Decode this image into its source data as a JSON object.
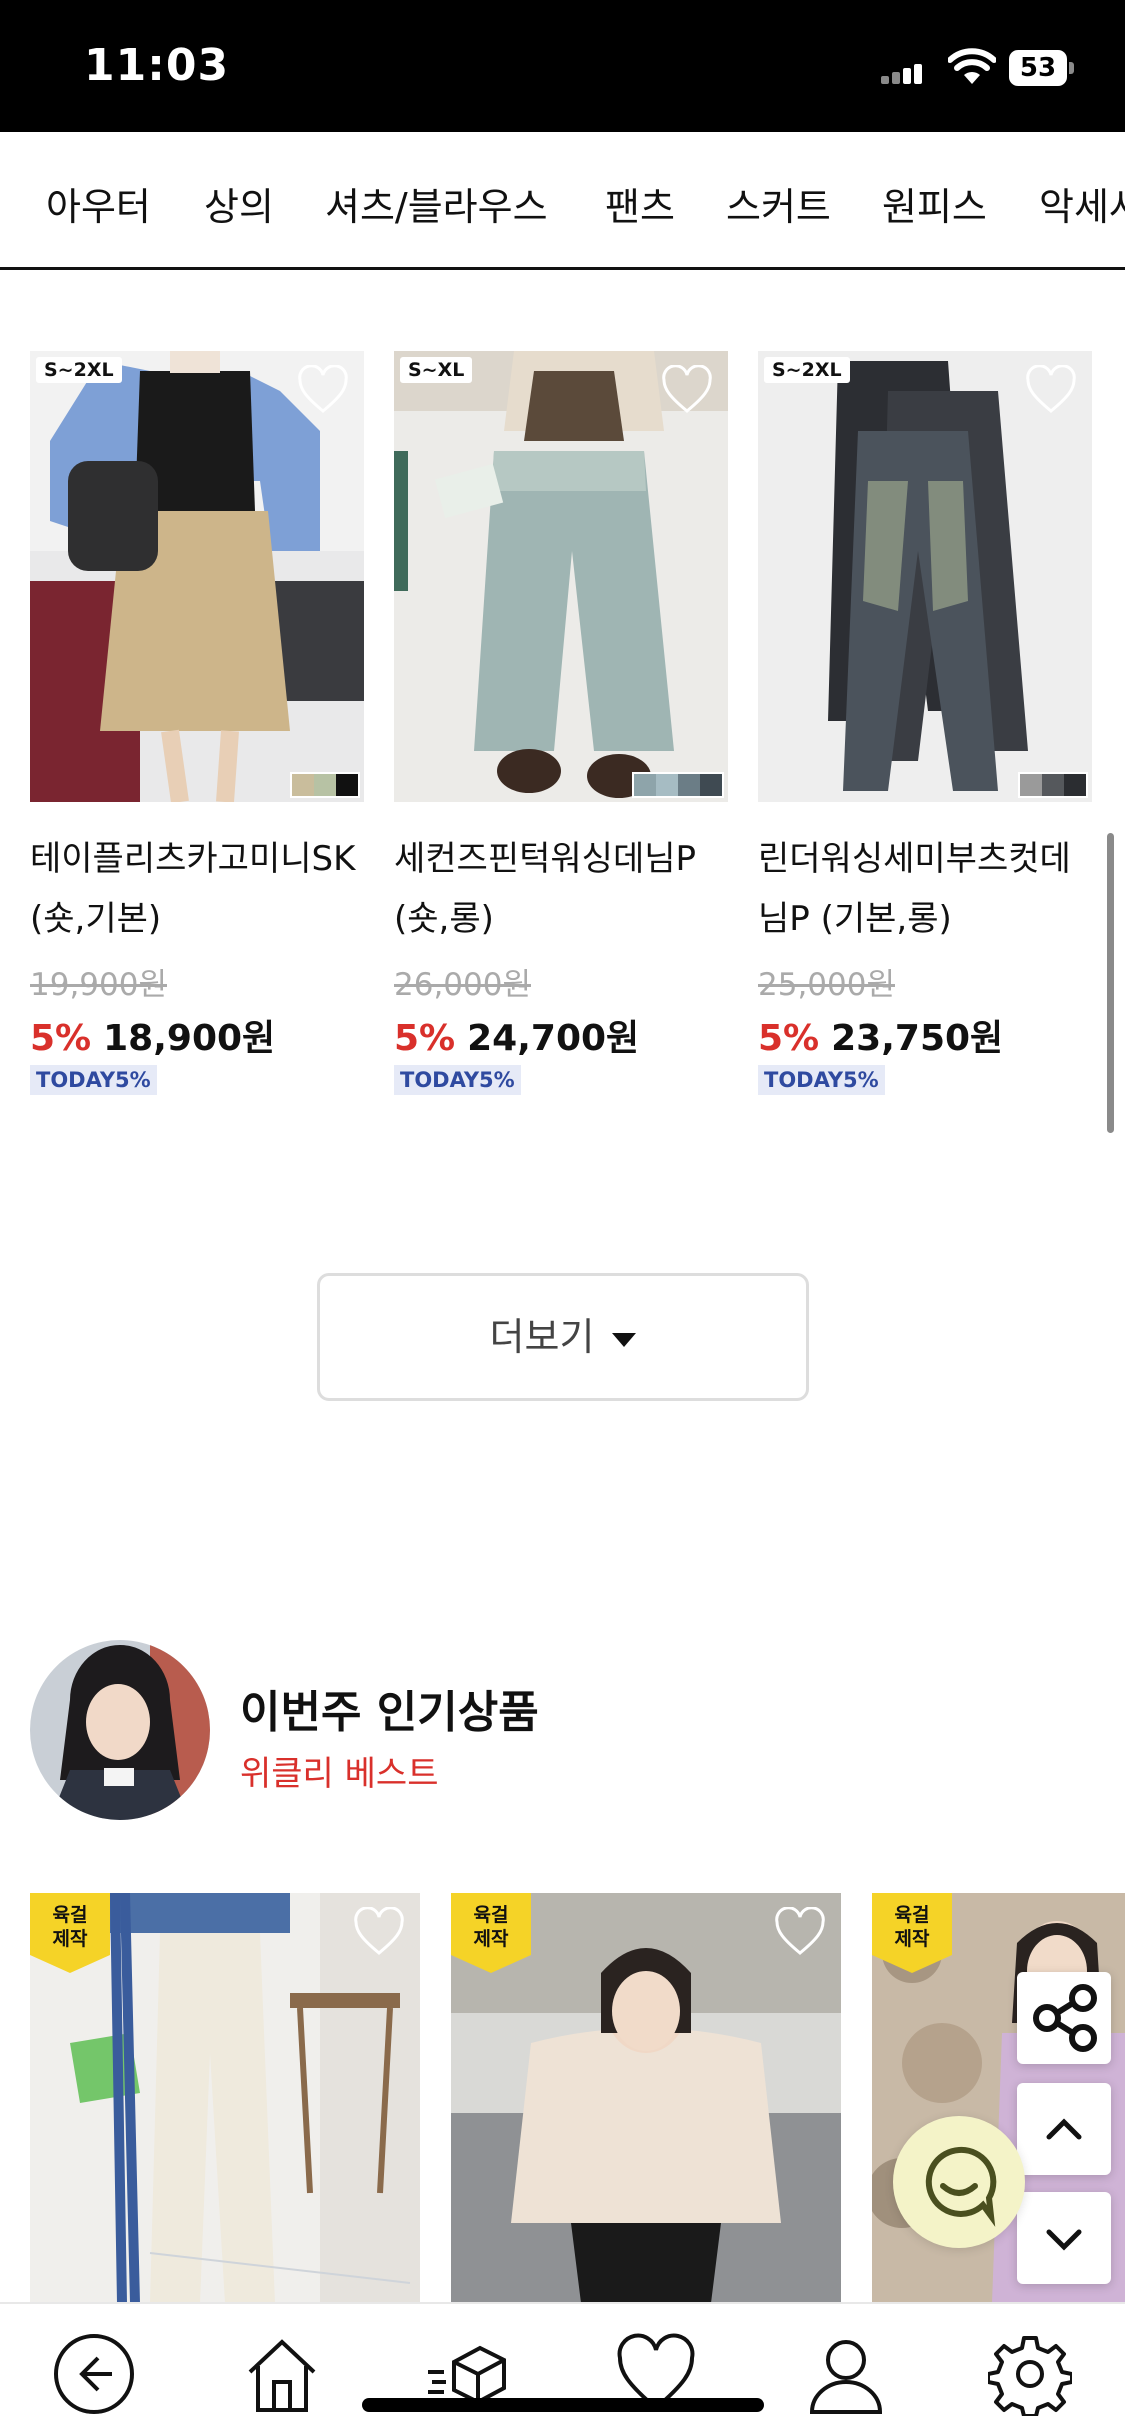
{
  "status_bar": {
    "time": "11:03",
    "battery": "53"
  },
  "categories": [
    "아우터",
    "상의",
    "셔츠/블라우스",
    "팬츠",
    "스커트",
    "원피스",
    "악세사"
  ],
  "products": [
    {
      "size": "S~2XL",
      "name": "테이플리츠카고미니SK (숏,기본)",
      "original_price": "19,900원",
      "discount": "5%",
      "price": "18,900원",
      "badge": "TODAY5%",
      "swatch_colors": [
        "#c9bd9c",
        "#b7c2a4",
        "#111111"
      ]
    },
    {
      "size": "S~XL",
      "name": "세컨즈핀턱워싱데님P (숏,롱)",
      "original_price": "26,000원",
      "discount": "5%",
      "price": "24,700원",
      "badge": "TODAY5%",
      "swatch_colors": [
        "#8ea4aa",
        "#a6bcc3",
        "#6b7d86",
        "#3f4a52"
      ]
    },
    {
      "size": "S~2XL",
      "name": "린더워싱세미부츠컷데님P (기본,롱)",
      "original_price": "25,000원",
      "discount": "5%",
      "price": "23,750원",
      "badge": "TODAY5%",
      "swatch_colors": [
        "#9a9a9a",
        "#55585c",
        "#2b2d31"
      ]
    }
  ],
  "more_button": {
    "label": "더보기"
  },
  "weekly_section": {
    "title": "이번주 인기상품",
    "subtitle": "위클리 베스트",
    "ribbon_label": "육걸\n제작",
    "cards": [
      {
        "ribbon_line1": "육걸",
        "ribbon_line2": "제작"
      },
      {
        "ribbon_line1": "육걸",
        "ribbon_line2": "제작"
      },
      {
        "ribbon_line1": "육걸",
        "ribbon_line2": "제작"
      }
    ]
  },
  "floating_buttons": [
    "share-icon",
    "arrow-up-icon",
    "arrow-down-icon",
    "chat-icon"
  ],
  "bottom_nav": [
    "back-icon",
    "home-icon",
    "delivery-box-icon",
    "heart-icon",
    "user-icon",
    "gear-icon"
  ],
  "colors": {
    "accent_red": "#d9302b",
    "badge_bg": "#e6eaf7",
    "badge_text": "#2f4aa0",
    "ribbon_yellow": "#f5d327",
    "chat_bg": "#f4f3c8"
  }
}
